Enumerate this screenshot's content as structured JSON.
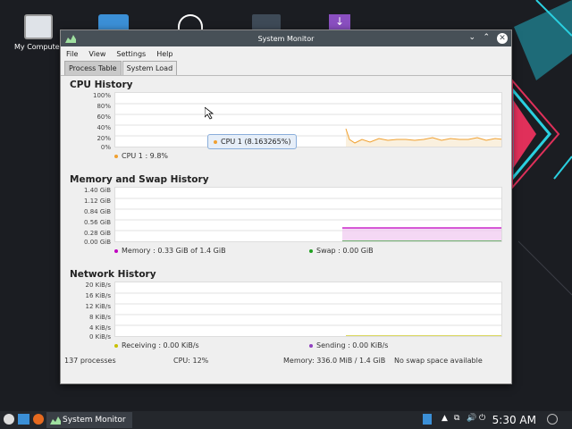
{
  "desktop": {
    "icons": [
      {
        "label": "My Computer"
      }
    ]
  },
  "window": {
    "title": "System Monitor",
    "menu": [
      "File",
      "View",
      "Settings",
      "Help"
    ],
    "tabs": [
      {
        "label": "Process Table",
        "active": true
      },
      {
        "label": "System Load",
        "active": false
      }
    ]
  },
  "cpu": {
    "title": "CPU History",
    "y_ticks": [
      "100%",
      "80%",
      "60%",
      "40%",
      "20%",
      "0%"
    ],
    "legend": "CPU 1 : 9.8%",
    "color": "#f0a030",
    "tooltip": "CPU 1 (8.163265%)"
  },
  "memory": {
    "title": "Memory and Swap History",
    "y_ticks": [
      "1.40 GiB",
      "1.12 GiB",
      "0.84 GiB",
      "0.56 GiB",
      "0.28 GiB",
      "0.00 GiB"
    ],
    "legend_memory": "Memory : 0.33 GiB of 1.4 GiB",
    "legend_swap": "Swap : 0.00 GiB",
    "memory_color": "#c000c0",
    "swap_color": "#20a020"
  },
  "network": {
    "title": "Network History",
    "y_ticks": [
      "20 KiB/s",
      "16 KiB/s",
      "12 KiB/s",
      "8 KiB/s",
      "4 KiB/s",
      "0 KiB/s"
    ],
    "legend_receiving": "Receiving : 0.00 KiB/s",
    "legend_sending": "Sending : 0.00 KiB/s",
    "receiving_color": "#c8c000",
    "sending_color": "#9040c0"
  },
  "status": {
    "processes": "137 processes",
    "cpu": "CPU: 12%",
    "memory": "Memory: 336.0 MiB / 1.4 GiB",
    "swap": "No swap space available"
  },
  "taskbar": {
    "task_label": "System Monitor",
    "clock": "5:30 AM"
  }
}
